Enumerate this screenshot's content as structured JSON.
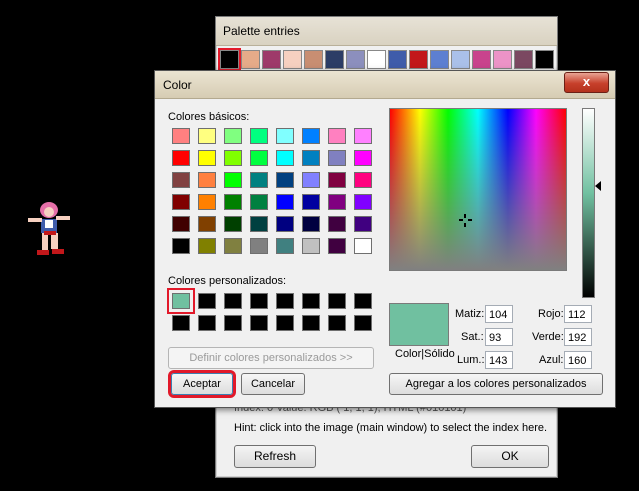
{
  "palette_window": {
    "title": "Palette entries",
    "swatches": [
      "#000000",
      "#e6ab89",
      "#9e3a6a",
      "#f6d0c0",
      "#c88e72",
      "#2c3d66",
      "#8c8fbd",
      "#ffffff",
      "#3f5caa",
      "#c2171a",
      "#5d7fd1",
      "#aac0e9",
      "#c9438d",
      "#ec93c7",
      "#7b4861",
      "#000000"
    ],
    "index_text": "Index: 0          Value: RGB (  1,  1,  1), HTML (#010101)",
    "hint": "Hint: click into the image (main window) to select the index here.",
    "refresh_label": "Refresh",
    "ok_label": "OK"
  },
  "color_dialog": {
    "title": "Color",
    "close_label": "x",
    "basic_label": "Colores básicos:",
    "basic_colors": [
      "#ff8080",
      "#ffff80",
      "#80ff80",
      "#00ff80",
      "#80ffff",
      "#0080ff",
      "#ff80c0",
      "#ff80ff",
      "#ff0000",
      "#ffff00",
      "#80ff00",
      "#00ff40",
      "#00ffff",
      "#0080c0",
      "#8080c0",
      "#ff00ff",
      "#804040",
      "#ff8040",
      "#00ff00",
      "#008080",
      "#004080",
      "#8080ff",
      "#800040",
      "#ff0080",
      "#800000",
      "#ff8000",
      "#008000",
      "#008040",
      "#0000ff",
      "#0000a0",
      "#800080",
      "#8000ff",
      "#400000",
      "#804000",
      "#004000",
      "#004040",
      "#000080",
      "#000040",
      "#400040",
      "#400080",
      "#000000",
      "#808000",
      "#808040",
      "#808080",
      "#408080",
      "#c0c0c0",
      "#400040",
      "#ffffff"
    ],
    "custom_label": "Colores personalizados:",
    "custom_colors": [
      "#70c0a0",
      "#000000",
      "#000000",
      "#000000",
      "#000000",
      "#000000",
      "#000000",
      "#000000",
      "#000000",
      "#000000",
      "#000000",
      "#000000",
      "#000000",
      "#000000",
      "#000000",
      "#000000"
    ],
    "define_label": "Definir colores personalizados >>",
    "accept_label": "Aceptar",
    "cancel_label": "Cancelar",
    "preview_color": "#70c0a0",
    "preview_caption": "Color|Sólido",
    "hue_label": "Matiz:",
    "hue": "104",
    "sat_label": "Sat.:",
    "sat": "93",
    "lum_label": "Lum.:",
    "lum": "143",
    "red_label": "Rojo:",
    "red": "112",
    "green_label": "Verde:",
    "green": "192",
    "blue_label": "Azul:",
    "blue": "160",
    "add_custom_label": "Agregar a los colores personalizados"
  }
}
